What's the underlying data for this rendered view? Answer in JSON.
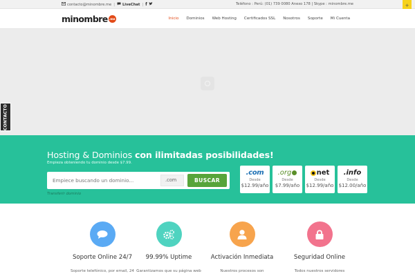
{
  "topbar": {
    "email": "contacto@minombre.me",
    "livechat": "LiveChat",
    "contact_info": "Teléfono : Perú: (01) 739 0080 Anexo 178 | Skype : minombre.me"
  },
  "corner_badge": "+",
  "logo": {
    "text": "minombre",
    "badge": ".me"
  },
  "nav": {
    "items": [
      {
        "label": "Inicio",
        "active": true
      },
      {
        "label": "Dominios"
      },
      {
        "label": "Web Hosting"
      },
      {
        "label": "Certificados SSL"
      },
      {
        "label": "Nosotros"
      },
      {
        "label": "Soporte"
      },
      {
        "label": "Mi Cuenta"
      }
    ]
  },
  "contact_tab": "CONTACTO",
  "domain_search": {
    "title_plain": "Hosting & Dominios",
    "title_bold": "con ilimitadas posibilidades!",
    "subtitle": "Empieza obteniendo tu dominio desde $7.99.",
    "input_placeholder": "Empiece buscando un dominio...",
    "tld_selected": ".com",
    "button_label": "BUSCAR",
    "transfer_link": "Transferir dominio"
  },
  "tld_cards": [
    {
      "name": ".com",
      "label": "Desde",
      "price": "$12.99/año"
    },
    {
      "name": ".org",
      "label": "Desde",
      "price": "$7.99/año"
    },
    {
      "name": "net",
      "label": "Desde",
      "price": "$12.99/año"
    },
    {
      "name": ".info",
      "label": "Desde",
      "price": "$12.00/año"
    }
  ],
  "features": [
    {
      "title": "Soporte Online 24/7",
      "desc": "Soporte telefónico, por email, 24",
      "color": "#5aaaf4",
      "icon": "chat-icon"
    },
    {
      "title": "99.99% Uptime",
      "desc": "Garantizamos que su página web",
      "color": "#4fd3c0",
      "icon": "gears-icon"
    },
    {
      "title": "Activación Inmediata",
      "desc": "Nuestros procesos son",
      "color": "#f7a44d",
      "icon": "user-icon"
    },
    {
      "title": "Seguridad Online",
      "desc": "Todos nuestros servidores",
      "color": "#f2738d",
      "icon": "lock-icon"
    }
  ],
  "colors": {
    "accent": "#e24a18",
    "band": "#27c19a",
    "search_button": "#57a43a",
    "hero": "#ececec"
  }
}
